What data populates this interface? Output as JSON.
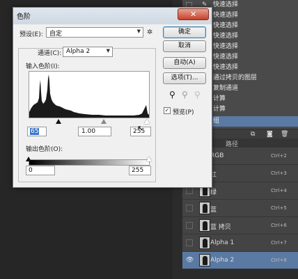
{
  "history": {
    "items": [
      {
        "label": "快速选择",
        "brush": true
      },
      {
        "label": "快速选择"
      },
      {
        "label": "快速选择"
      },
      {
        "label": "快速选择"
      },
      {
        "label": "快速选择"
      },
      {
        "label": "快速选择"
      },
      {
        "label": "快速选择"
      },
      {
        "label": "通过拷贝的图层"
      },
      {
        "label": "复制通道"
      },
      {
        "label": "计算"
      },
      {
        "label": "计算"
      },
      {
        "label": "组",
        "selected": true
      }
    ]
  },
  "channels": {
    "tab_label": "路径",
    "rows": [
      {
        "name": "RGB",
        "shortcut": "Ctrl+2"
      },
      {
        "name": "红",
        "shortcut": "Ctrl+3"
      },
      {
        "name": "绿",
        "shortcut": "Ctrl+4"
      },
      {
        "name": "蓝",
        "shortcut": "Ctrl+5"
      },
      {
        "name": "蓝 拷贝",
        "shortcut": "Ctrl+6"
      },
      {
        "name": "Alpha 1",
        "shortcut": "Ctrl+7"
      },
      {
        "name": "Alpha 2",
        "shortcut": "Ctrl+8",
        "selected": true
      }
    ]
  },
  "dialog": {
    "title": "色阶",
    "close_glyph": "✕",
    "preset_label": "预设(E):",
    "preset_value": "自定",
    "channel_label": "通道(C):",
    "channel_value": "Alpha 2",
    "input_levels_label": "输入色阶(I):",
    "input_black": "65",
    "input_gamma": "1.00",
    "input_white": "255",
    "output_levels_label": "输出色阶(O):",
    "output_black": "0",
    "output_white": "255",
    "buttons": {
      "ok": "确定",
      "cancel": "取消",
      "auto": "自动(A)",
      "options": "选项(T)..."
    },
    "preview_label": "预览(P)",
    "preview_checked": true
  },
  "colors": {
    "accent_selection": "#5a7aa4",
    "dialog_bg": "#f0f0f0",
    "close_red": "#c6412b"
  }
}
